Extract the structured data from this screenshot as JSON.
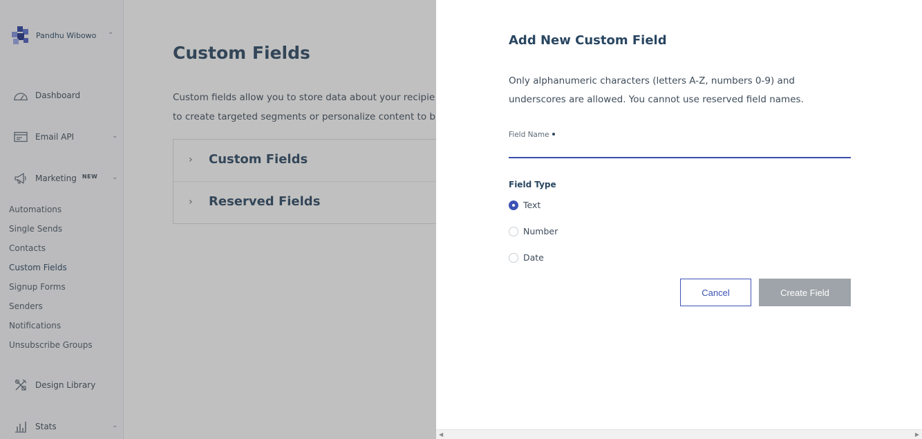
{
  "account": {
    "name": "Pandhu Wibowo"
  },
  "sidebar": {
    "nav": [
      {
        "label": "Dashboard",
        "icon": "dashboard-gauge-icon",
        "has_chevron": false
      },
      {
        "label": "Email API",
        "icon": "email-api-icon",
        "has_chevron": true
      },
      {
        "label": "Marketing",
        "icon": "megaphone-icon",
        "has_chevron": true,
        "badge": "NEW"
      }
    ],
    "marketing_items": [
      "Automations",
      "Single Sends",
      "Contacts",
      "Custom Fields",
      "Signup Forms",
      "Senders",
      "Notifications",
      "Unsubscribe Groups"
    ],
    "bottom_nav": [
      {
        "label": "Design Library",
        "icon": "design-library-icon",
        "has_chevron": false
      },
      {
        "label": "Stats",
        "icon": "stats-bar-icon",
        "has_chevron": true
      }
    ]
  },
  "main": {
    "title": "Custom Fields",
    "description_line1": "Custom fields allow you to store data about your recipie",
    "description_line2": "to create targeted segments or personalize content to b",
    "accordion": [
      "Custom Fields",
      "Reserved Fields"
    ]
  },
  "drawer": {
    "title": "Add New Custom Field",
    "description": "Only alphanumeric characters (letters A-Z, numbers 0-9) and underscores are allowed. You cannot use reserved field names.",
    "field_name_label": "Field Name",
    "field_name_value": "",
    "field_type_label": "Field Type",
    "field_types": [
      "Text",
      "Number",
      "Date"
    ],
    "selected_type": "Text",
    "cancel_label": "Cancel",
    "create_label": "Create Field"
  },
  "colors": {
    "accent": "#3c52b4",
    "title_text": "#294661",
    "disabled_button": "#9ea4a9",
    "overlay": "rgba(70,70,70,0.34)"
  }
}
